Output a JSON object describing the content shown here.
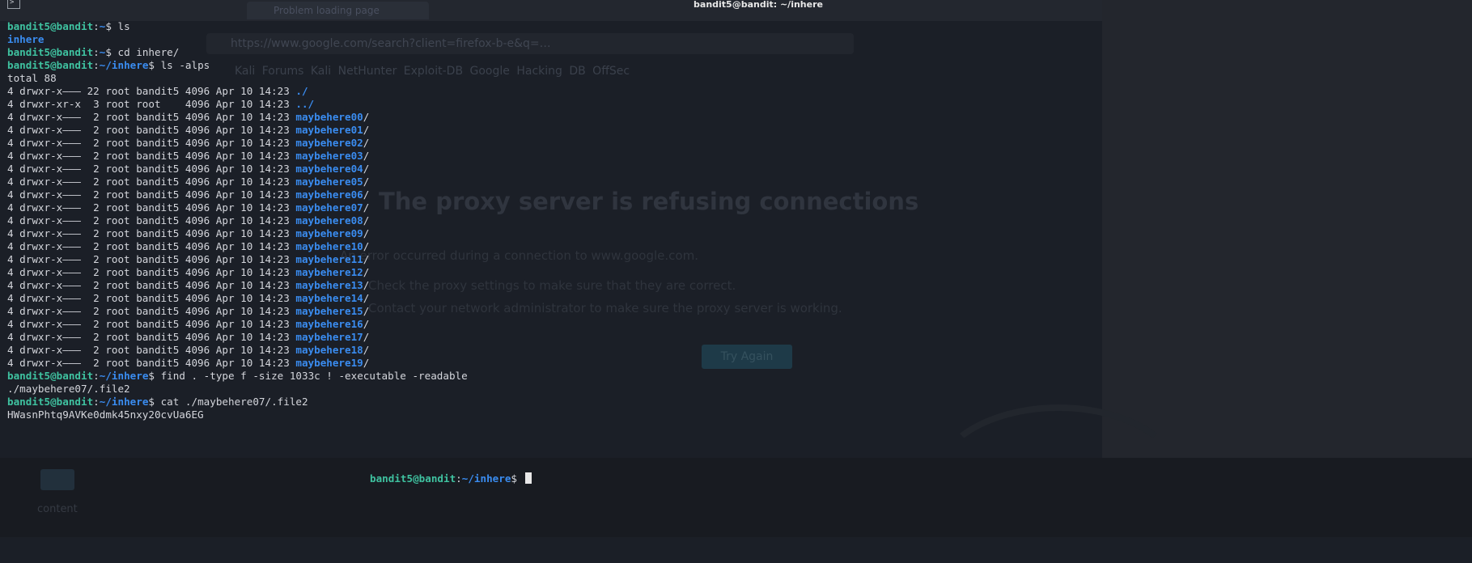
{
  "window": {
    "title": "bandit5@bandit: ~/inhere",
    "icon": "terminal-icon"
  },
  "background_browser": {
    "tab_title": "Problem loading page",
    "url": "https://www.google.com/search?client=firefox-b-e&q=…",
    "bookmarks": "Kali Forums   Kali NetHunter   Exploit-DB   Google Hacking DB   OffSec",
    "error_title": "The proxy server is refusing connections",
    "error_line1": "An error occurred during a connection to www.google.com.",
    "error_line2": "Check the proxy settings to make sure that they are correct.",
    "error_line3": "Contact your network administrator to make sure the proxy server is working.",
    "try_again": "Try Again",
    "content_label": "content"
  },
  "prompt": {
    "user_host": "bandit5@bandit",
    "colon": ":",
    "home_path": "~",
    "inhere_path": "~/inhere",
    "dollar": "$ "
  },
  "commands": {
    "ls": "ls",
    "cd": "cd inhere/",
    "ls_alps": "ls -alps",
    "find": "find . -type f -size 1033c ! -executable -readable",
    "cat": "cat ./maybehere07/.file2"
  },
  "ls_output": {
    "inhere": "inhere"
  },
  "listing": {
    "total": "total 88",
    "dot_prefix": "4 drwxr-x——— 22 root bandit5 4096 Apr 10 14:23 ",
    "dot": "./",
    "dotdot_prefix": "4 drwxr-xr-x  3 root root    4096 Apr 10 14:23 ",
    "dotdot": "../",
    "row_prefix": "4 drwxr-x———  2 root bandit5 4096 Apr 10 14:23 ",
    "slash": "/",
    "dirs": [
      "maybehere00",
      "maybehere01",
      "maybehere02",
      "maybehere03",
      "maybehere04",
      "maybehere05",
      "maybehere06",
      "maybehere07",
      "maybehere08",
      "maybehere09",
      "maybehere10",
      "maybehere11",
      "maybehere12",
      "maybehere13",
      "maybehere14",
      "maybehere15",
      "maybehere16",
      "maybehere17",
      "maybehere18",
      "maybehere19"
    ]
  },
  "find_output": "./maybehere07/.file2",
  "cat_output": "HWasnPhtq9AVKe0dmk45nxy20cvUa6EG",
  "colors": {
    "prompt_user": "#3fc2a0",
    "prompt_path": "#3a8cf0",
    "directory": "#3a8cf0",
    "text": "#d4d6dc"
  }
}
